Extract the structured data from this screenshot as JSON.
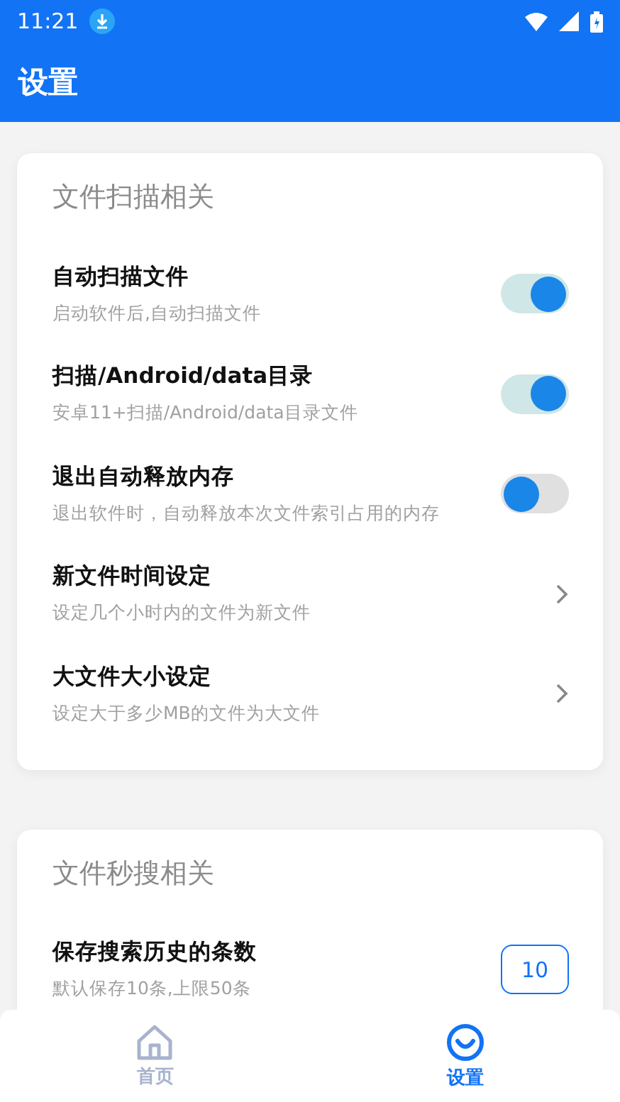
{
  "status_bar": {
    "time": "11:21"
  },
  "header": {
    "title": "设置"
  },
  "sections": [
    {
      "title": "文件扫描相关",
      "items": [
        {
          "kind": "toggle",
          "title": "自动扫描文件",
          "subtitle": "启动软件后,自动扫描文件",
          "on": true
        },
        {
          "kind": "toggle",
          "title": "扫描/Android/data目录",
          "subtitle": "安卓11+扫描/Android/data目录文件",
          "on": true
        },
        {
          "kind": "toggle",
          "title": "退出自动释放内存",
          "subtitle": "退出软件时，自动释放本次文件索引占用的内存",
          "on": false
        },
        {
          "kind": "arrow",
          "title": "新文件时间设定",
          "subtitle": "设定几个小时内的文件为新文件"
        },
        {
          "kind": "arrow",
          "title": "大文件大小设定",
          "subtitle": "设定大于多少MB的文件为大文件"
        }
      ]
    },
    {
      "title": "文件秒搜相关",
      "items": [
        {
          "kind": "number",
          "title": "保存搜索历史的条数",
          "subtitle": "默认保存10条,上限50条",
          "value": "10"
        }
      ]
    }
  ],
  "bottom_nav": [
    {
      "kind": "home",
      "label": "首页",
      "selected": false
    },
    {
      "kind": "settings",
      "label": "设置",
      "selected": true
    }
  ]
}
